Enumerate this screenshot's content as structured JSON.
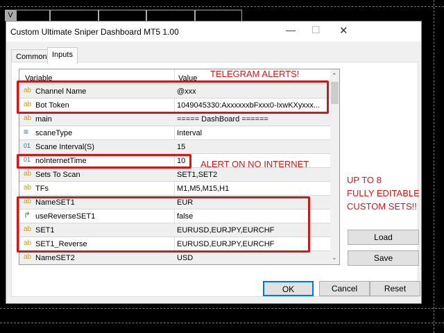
{
  "chart_tab": "V",
  "window": {
    "title": "Custom Ultimate Sniper Dashboard MT5 1.00",
    "minimize": "—",
    "maximize": "☐",
    "close": "✕"
  },
  "tabs": [
    {
      "label": "Common"
    },
    {
      "label": "Inputs"
    }
  ],
  "table": {
    "headers": [
      "Variable",
      "Value"
    ],
    "rows": [
      {
        "icon": "ab",
        "name": "Channel Name",
        "value": "@xxx"
      },
      {
        "icon": "ab",
        "name": "Bot Token",
        "value": "1049045330:AxxxxxxbFxxx0-IxwKXyxxx..."
      },
      {
        "icon": "ab",
        "name": "main",
        "value": "===== DashBoard ======"
      },
      {
        "icon": "enum",
        "name": "scaneType",
        "value": "Interval"
      },
      {
        "icon": "01",
        "name": "Scane Interval(S)",
        "value": "15"
      },
      {
        "icon": "01",
        "name": "noInternetTime",
        "value": "10"
      },
      {
        "icon": "ab",
        "name": "Sets To Scan",
        "value": "SET1,SET2"
      },
      {
        "icon": "ab",
        "name": "TFs",
        "value": "M1,M5,M15,H1"
      },
      {
        "icon": "ab",
        "name": "NameSET1",
        "value": "EUR"
      },
      {
        "icon": "bool",
        "name": "useReverseSET1",
        "value": "false"
      },
      {
        "icon": "ab",
        "name": "SET1",
        "value": "EURUSD,EURJPY,EURCHF"
      },
      {
        "icon": "ab",
        "name": "SET1_Reverse",
        "value": "EURUSD,EURJPY,EURCHF"
      },
      {
        "icon": "ab",
        "name": "NameSET2",
        "value": "USD"
      }
    ]
  },
  "side_buttons": {
    "load": "Load",
    "save": "Save"
  },
  "footer": {
    "ok": "OK",
    "cancel": "Cancel",
    "reset": "Reset"
  },
  "annotations": {
    "telegram": "TELEGRAM ALERTS!",
    "no_internet": "ALERT ON NO INTERNET",
    "sets_1": "UP TO 8",
    "sets_2": "FULLY EDITABLE",
    "sets_3": "CUSTOM SETS!!"
  },
  "colors": {
    "annotation": "#d01818",
    "accent": "#0078d7"
  }
}
